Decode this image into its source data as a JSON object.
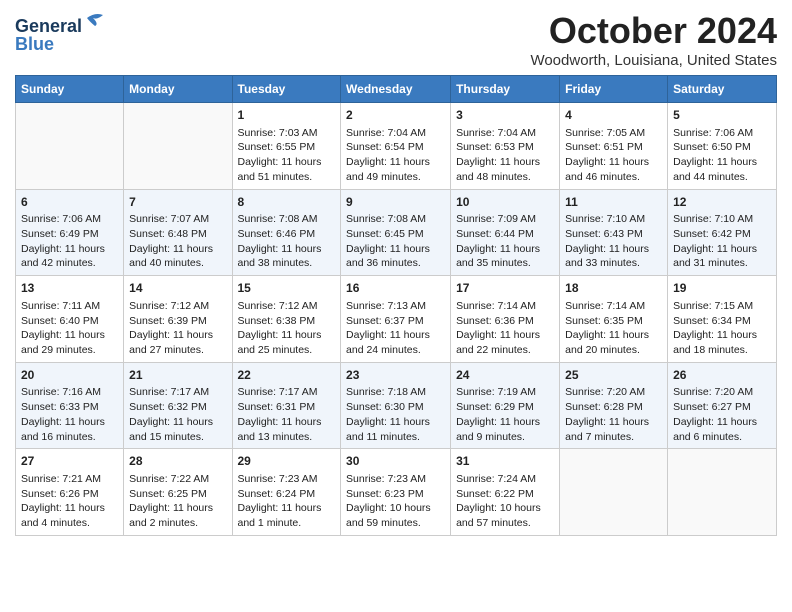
{
  "header": {
    "logo_line1": "General",
    "logo_line2": "Blue",
    "month": "October 2024",
    "location": "Woodworth, Louisiana, United States"
  },
  "days_of_week": [
    "Sunday",
    "Monday",
    "Tuesday",
    "Wednesday",
    "Thursday",
    "Friday",
    "Saturday"
  ],
  "weeks": [
    [
      {
        "day": "",
        "info": ""
      },
      {
        "day": "",
        "info": ""
      },
      {
        "day": "1",
        "info": "Sunrise: 7:03 AM\nSunset: 6:55 PM\nDaylight: 11 hours and 51 minutes."
      },
      {
        "day": "2",
        "info": "Sunrise: 7:04 AM\nSunset: 6:54 PM\nDaylight: 11 hours and 49 minutes."
      },
      {
        "day": "3",
        "info": "Sunrise: 7:04 AM\nSunset: 6:53 PM\nDaylight: 11 hours and 48 minutes."
      },
      {
        "day": "4",
        "info": "Sunrise: 7:05 AM\nSunset: 6:51 PM\nDaylight: 11 hours and 46 minutes."
      },
      {
        "day": "5",
        "info": "Sunrise: 7:06 AM\nSunset: 6:50 PM\nDaylight: 11 hours and 44 minutes."
      }
    ],
    [
      {
        "day": "6",
        "info": "Sunrise: 7:06 AM\nSunset: 6:49 PM\nDaylight: 11 hours and 42 minutes."
      },
      {
        "day": "7",
        "info": "Sunrise: 7:07 AM\nSunset: 6:48 PM\nDaylight: 11 hours and 40 minutes."
      },
      {
        "day": "8",
        "info": "Sunrise: 7:08 AM\nSunset: 6:46 PM\nDaylight: 11 hours and 38 minutes."
      },
      {
        "day": "9",
        "info": "Sunrise: 7:08 AM\nSunset: 6:45 PM\nDaylight: 11 hours and 36 minutes."
      },
      {
        "day": "10",
        "info": "Sunrise: 7:09 AM\nSunset: 6:44 PM\nDaylight: 11 hours and 35 minutes."
      },
      {
        "day": "11",
        "info": "Sunrise: 7:10 AM\nSunset: 6:43 PM\nDaylight: 11 hours and 33 minutes."
      },
      {
        "day": "12",
        "info": "Sunrise: 7:10 AM\nSunset: 6:42 PM\nDaylight: 11 hours and 31 minutes."
      }
    ],
    [
      {
        "day": "13",
        "info": "Sunrise: 7:11 AM\nSunset: 6:40 PM\nDaylight: 11 hours and 29 minutes."
      },
      {
        "day": "14",
        "info": "Sunrise: 7:12 AM\nSunset: 6:39 PM\nDaylight: 11 hours and 27 minutes."
      },
      {
        "day": "15",
        "info": "Sunrise: 7:12 AM\nSunset: 6:38 PM\nDaylight: 11 hours and 25 minutes."
      },
      {
        "day": "16",
        "info": "Sunrise: 7:13 AM\nSunset: 6:37 PM\nDaylight: 11 hours and 24 minutes."
      },
      {
        "day": "17",
        "info": "Sunrise: 7:14 AM\nSunset: 6:36 PM\nDaylight: 11 hours and 22 minutes."
      },
      {
        "day": "18",
        "info": "Sunrise: 7:14 AM\nSunset: 6:35 PM\nDaylight: 11 hours and 20 minutes."
      },
      {
        "day": "19",
        "info": "Sunrise: 7:15 AM\nSunset: 6:34 PM\nDaylight: 11 hours and 18 minutes."
      }
    ],
    [
      {
        "day": "20",
        "info": "Sunrise: 7:16 AM\nSunset: 6:33 PM\nDaylight: 11 hours and 16 minutes."
      },
      {
        "day": "21",
        "info": "Sunrise: 7:17 AM\nSunset: 6:32 PM\nDaylight: 11 hours and 15 minutes."
      },
      {
        "day": "22",
        "info": "Sunrise: 7:17 AM\nSunset: 6:31 PM\nDaylight: 11 hours and 13 minutes."
      },
      {
        "day": "23",
        "info": "Sunrise: 7:18 AM\nSunset: 6:30 PM\nDaylight: 11 hours and 11 minutes."
      },
      {
        "day": "24",
        "info": "Sunrise: 7:19 AM\nSunset: 6:29 PM\nDaylight: 11 hours and 9 minutes."
      },
      {
        "day": "25",
        "info": "Sunrise: 7:20 AM\nSunset: 6:28 PM\nDaylight: 11 hours and 7 minutes."
      },
      {
        "day": "26",
        "info": "Sunrise: 7:20 AM\nSunset: 6:27 PM\nDaylight: 11 hours and 6 minutes."
      }
    ],
    [
      {
        "day": "27",
        "info": "Sunrise: 7:21 AM\nSunset: 6:26 PM\nDaylight: 11 hours and 4 minutes."
      },
      {
        "day": "28",
        "info": "Sunrise: 7:22 AM\nSunset: 6:25 PM\nDaylight: 11 hours and 2 minutes."
      },
      {
        "day": "29",
        "info": "Sunrise: 7:23 AM\nSunset: 6:24 PM\nDaylight: 11 hours and 1 minute."
      },
      {
        "day": "30",
        "info": "Sunrise: 7:23 AM\nSunset: 6:23 PM\nDaylight: 10 hours and 59 minutes."
      },
      {
        "day": "31",
        "info": "Sunrise: 7:24 AM\nSunset: 6:22 PM\nDaylight: 10 hours and 57 minutes."
      },
      {
        "day": "",
        "info": ""
      },
      {
        "day": "",
        "info": ""
      }
    ]
  ]
}
